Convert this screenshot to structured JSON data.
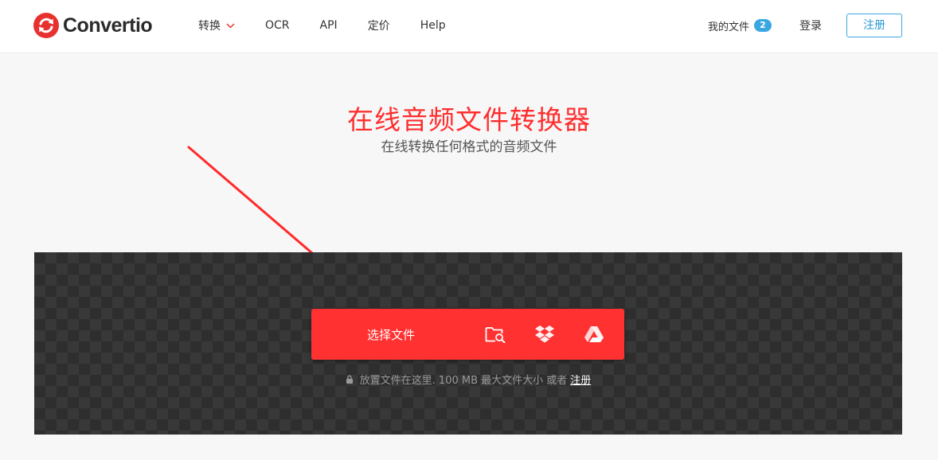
{
  "header": {
    "logo_text": "Convertio",
    "nav": [
      {
        "label": "转换",
        "has_dropdown": true
      },
      {
        "label": "OCR"
      },
      {
        "label": "API"
      },
      {
        "label": "定价"
      },
      {
        "label": "Help"
      }
    ],
    "my_files_label": "我的文件",
    "my_files_count": "2",
    "login_label": "登录",
    "register_label": "注册"
  },
  "hero": {
    "title": "在线音频文件转换器",
    "subtitle": "在线转换任何格式的音频文件"
  },
  "upload": {
    "choose_label": "选择文件",
    "sources": [
      "folder-search-icon",
      "dropbox-icon",
      "google-drive-icon"
    ],
    "hint_text": "放置文件在这里. 100 MB 最大文件大小 或者",
    "hint_link": "注册"
  },
  "colors": {
    "accent": "#ff3131",
    "brand_red": "#e53935",
    "badge_blue": "#3aa7e0",
    "dropzone_bg": "#2e2e2e"
  }
}
